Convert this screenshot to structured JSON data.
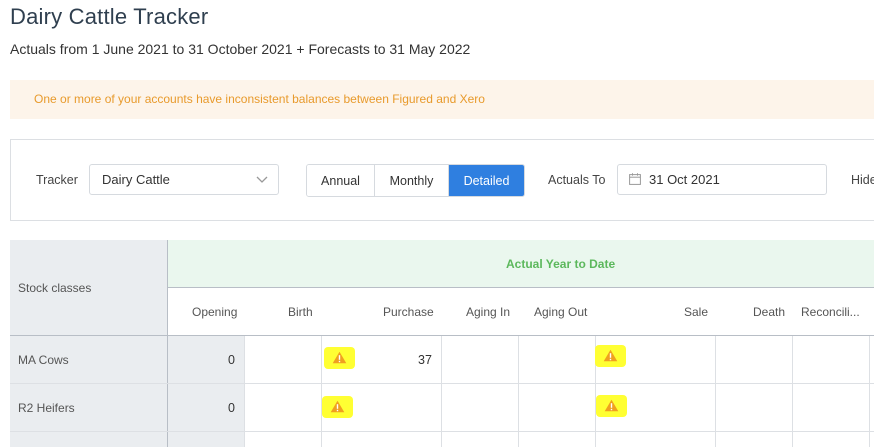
{
  "page": {
    "title": "Dairy Cattle Tracker",
    "subtitle": "Actuals from 1 June 2021 to 31 October 2021 + Forecasts to 31 May 2022"
  },
  "alert": {
    "message": "One or more of your accounts have inconsistent balances between Figured and Xero",
    "color": "#e89a2c"
  },
  "filters": {
    "tracker_label": "Tracker",
    "tracker_value": "Dairy Cattle",
    "view_options": [
      "Annual",
      "Monthly",
      "Detailed"
    ],
    "view_selected": "Detailed",
    "actuals_to_label": "Actuals To",
    "actuals_to_value": "31 Oct 2021",
    "hide_label": "Hide"
  },
  "table": {
    "row_header": "Stock classes",
    "group_header": "Actual Year to Date",
    "columns": [
      "Opening",
      "Birth",
      "Purchase",
      "Aging In",
      "Aging Out",
      "Sale",
      "Death",
      "Reconcili..."
    ],
    "rows": [
      {
        "label": "MA Cows",
        "opening": "0",
        "purchase": "37",
        "birth_warning": "warning-icon",
        "aging_out_warning": "warning-icon"
      },
      {
        "label": "R2 Heifers",
        "opening": "0",
        "purchase": "",
        "birth_warning": "warning-icon",
        "aging_out_warning": "warning-icon"
      }
    ]
  },
  "colors": {
    "accent": "#2f7fe0",
    "group_header_text": "#5cb85c",
    "highlight": "#ffff33",
    "warning": "#f0a01f"
  }
}
